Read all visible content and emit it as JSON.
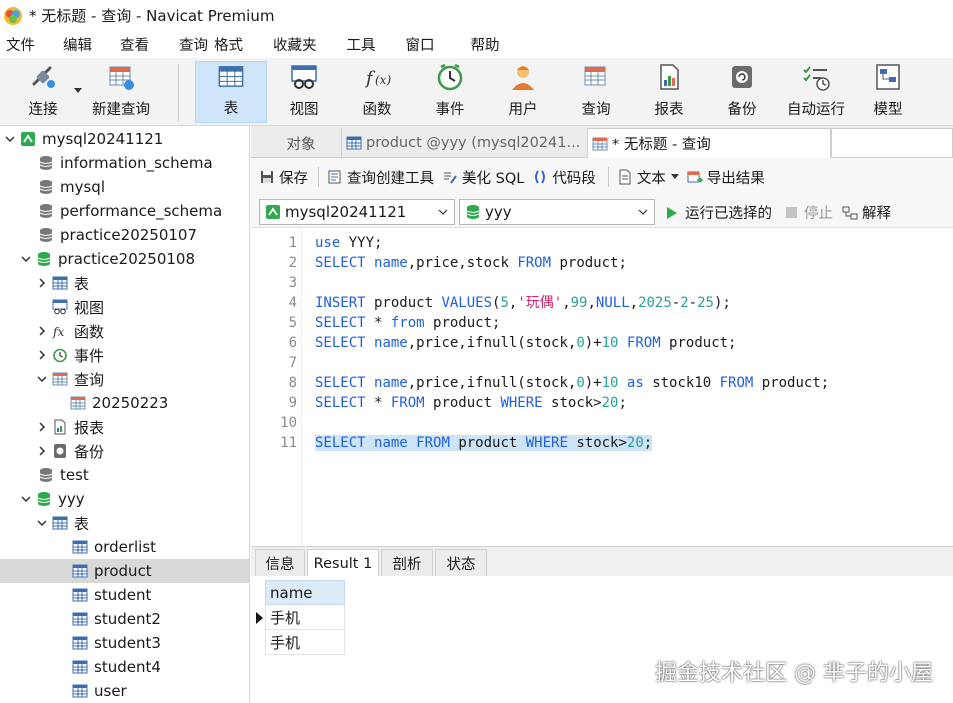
{
  "window": {
    "title": "* 无标题 - 查询 - Navicat Premium"
  },
  "menu": [
    "文件",
    "编辑",
    "查看",
    "查询",
    "格式",
    "收藏夹",
    "工具",
    "窗口",
    "帮助"
  ],
  "toolbar": {
    "connect": "连接",
    "new_query": "新建查询",
    "table": "表",
    "view": "视图",
    "function": "函数",
    "event": "事件",
    "user": "用户",
    "query": "查询",
    "report": "报表",
    "backup": "备份",
    "autorun": "自动运行",
    "model": "模型"
  },
  "tree": [
    {
      "label": "mysql20241121"
    },
    {
      "label": "information_schema"
    },
    {
      "label": "mysql"
    },
    {
      "label": "performance_schema"
    },
    {
      "label": "practice20250107"
    },
    {
      "label": "practice20250108"
    },
    {
      "label": "表"
    },
    {
      "label": "视图"
    },
    {
      "label": "函数"
    },
    {
      "label": "事件"
    },
    {
      "label": "查询"
    },
    {
      "label": "20250223"
    },
    {
      "label": "报表"
    },
    {
      "label": "备份"
    },
    {
      "label": "test"
    },
    {
      "label": "yyy"
    },
    {
      "label": "表"
    },
    {
      "label": "orderlist"
    },
    {
      "label": "product"
    },
    {
      "label": "student"
    },
    {
      "label": "student2"
    },
    {
      "label": "student3"
    },
    {
      "label": "student4"
    },
    {
      "label": "user"
    }
  ],
  "tabs": {
    "objects": "对象",
    "product_tab": "product @yyy (mysql20241...",
    "query_tab": "* 无标题 - 查询"
  },
  "query_toolbar": {
    "save": "保存",
    "builder": "查询创建工具",
    "beautify": "美化 SQL",
    "snippet": "代码段",
    "text": "文本",
    "export": "导出结果"
  },
  "connection": {
    "server": "mysql20241121",
    "database": "yyy",
    "run_selected": "运行已选择的",
    "stop": "停止",
    "explain": "解释"
  },
  "editor": {
    "line_numbers": [
      "1",
      "2",
      "3",
      "4",
      "5",
      "6",
      "7",
      "8",
      "9",
      "10",
      "11"
    ]
  },
  "result_tabs": [
    "信息",
    "Result 1",
    "剖析",
    "状态"
  ],
  "result": {
    "column": "name",
    "rows": [
      "手机",
      "手机"
    ]
  },
  "watermark": "掘金技术社区 @ 芈子的小屋"
}
